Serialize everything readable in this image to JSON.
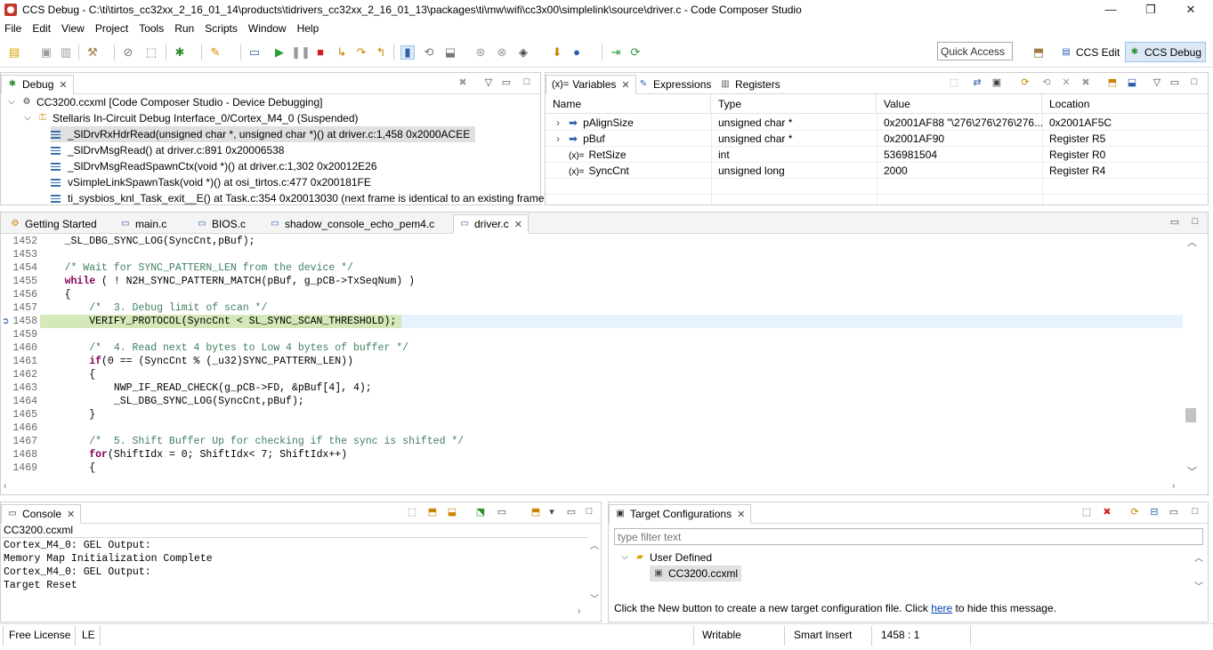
{
  "window": {
    "title": "CCS Debug - C:\\ti\\tirtos_cc32xx_2_16_01_14\\products\\tidrivers_cc32xx_2_16_01_13\\packages\\ti\\mw\\wifi\\cc3x00\\simplelink\\source\\driver.c - Code Composer Studio",
    "minimize": "—",
    "maximize": "❐",
    "close": "✕"
  },
  "menu": [
    "File",
    "Edit",
    "View",
    "Project",
    "Tools",
    "Run",
    "Scripts",
    "Window",
    "Help"
  ],
  "toolbar": {
    "quick_access": "Quick Access",
    "perspectives": [
      "CCS Edit",
      "CCS Debug"
    ],
    "accent": "#dbe9f7"
  },
  "debug_view": {
    "tab_label": "Debug",
    "tree": [
      {
        "text": "CC3200.ccxml [Code Composer Studio - Device Debugging]"
      },
      {
        "text": "Stellaris In-Circuit Debug Interface_0/Cortex_M4_0 (Suspended)"
      },
      {
        "text": "_SlDrvRxHdrRead(unsigned char *, unsigned char *)() at driver.c:1,458 0x2000ACEE"
      },
      {
        "text": "_SlDrvMsgRead() at driver.c:891 0x20006538"
      },
      {
        "text": "_SlDrvMsgReadSpawnCtx(void *)() at driver.c:1,302 0x20012E26"
      },
      {
        "text": "vSimpleLinkSpawnTask(void *)() at osi_tirtos.c:477 0x200181FE"
      },
      {
        "text": "ti_sysbios_knl_Task_exit__E() at Task.c:354 0x20013030  (next frame is identical to an existing frame)"
      }
    ]
  },
  "variables_view": {
    "tabs": [
      "Variables",
      "Expressions",
      "Registers"
    ],
    "tab_prefix": "(x)=",
    "columns": [
      "Name",
      "Type",
      "Value",
      "Location"
    ],
    "rows": [
      {
        "name": "pAlignSize",
        "type": "unsigned char *",
        "value": "0x2001AF88 \"\\276\\276\\276\\276...",
        "location": "0x2001AF5C"
      },
      {
        "name": "pBuf",
        "type": "unsigned char *",
        "value": "0x2001AF90",
        "location": "Register R5"
      },
      {
        "name": "RetSize",
        "type": "int",
        "value": "536981504",
        "location": "Register R0"
      },
      {
        "name": "SyncCnt",
        "type": "unsigned long",
        "value": "2000",
        "location": "Register R4"
      }
    ],
    "row_prefix": "(x)="
  },
  "editor": {
    "tabs": [
      "Getting Started",
      "main.c",
      "BIOS.c",
      "shadow_console_echo_pem4.c",
      "driver.c"
    ],
    "lines": [
      {
        "num": "1452",
        "code": "    _SL_DBG_SYNC_LOG(SyncCnt,pBuf);"
      },
      {
        "num": "1453",
        "code": ""
      },
      {
        "num": "1454",
        "code": "    /* Wait for SYNC_PATTERN_LEN from the device */"
      },
      {
        "num": "1455",
        "code": "    while ( ! N2H_SYNC_PATTERN_MATCH(pBuf, g_pCB->TxSeqNum) )"
      },
      {
        "num": "1456",
        "code": "    {"
      },
      {
        "num": "1457",
        "code": "        /*  3. Debug limit of scan */"
      },
      {
        "num": "1458",
        "code": "        VERIFY_PROTOCOL(SyncCnt < SL_SYNC_SCAN_THRESHOLD);"
      },
      {
        "num": "1459",
        "code": ""
      },
      {
        "num": "1460",
        "code": "        /*  4. Read next 4 bytes to Low 4 bytes of buffer */"
      },
      {
        "num": "1461",
        "code": "        if(0 == (SyncCnt % (_u32)SYNC_PATTERN_LEN))"
      },
      {
        "num": "1462",
        "code": "        {"
      },
      {
        "num": "1463",
        "code": "            NWP_IF_READ_CHECK(g_pCB->FD, &pBuf[4], 4);"
      },
      {
        "num": "1464",
        "code": "            _SL_DBG_SYNC_LOG(SyncCnt,pBuf);"
      },
      {
        "num": "1465",
        "code": "        }"
      },
      {
        "num": "1466",
        "code": ""
      },
      {
        "num": "1467",
        "code": "        /*  5. Shift Buffer Up for checking if the sync is shifted */"
      },
      {
        "num": "1468",
        "code": "        for(ShiftIdx = 0; ShiftIdx< 7; ShiftIdx++)"
      },
      {
        "num": "1469",
        "code": "        {"
      }
    ],
    "highlight_color": "#d4e8b8"
  },
  "console_view": {
    "tab_label": "Console",
    "context": "CC3200.ccxml",
    "lines": [
      "Cortex_M4_0: GEL Output:",
      "Memory Map Initialization Complete",
      "Cortex_M4_0: GEL Output:",
      "Target Reset"
    ]
  },
  "target_config": {
    "tab_label": "Target Configurations",
    "filter_placeholder": "type filter text",
    "folder": "User Defined",
    "file": "CC3200.ccxml",
    "message_pre": "Click the New button to create a new target configuration file. Click ",
    "message_link": "here",
    "message_post": " to hide this message."
  },
  "status": {
    "license": "Free License",
    "line_ending": "LE",
    "mode": "Writable",
    "insert": "Smart Insert",
    "position": "1458 : 1"
  }
}
